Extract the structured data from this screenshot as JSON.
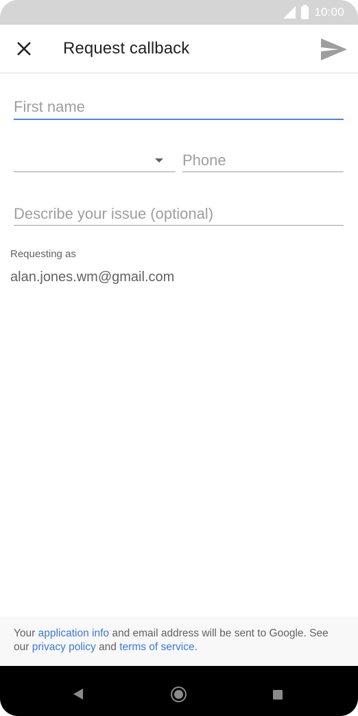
{
  "status_bar": {
    "time": "10:00",
    "icons": [
      "signal-icon",
      "battery-icon"
    ]
  },
  "app_bar": {
    "title": "Request callback",
    "close_icon": "close-icon",
    "send_icon": "send-icon"
  },
  "form": {
    "first_name": {
      "placeholder": "First name",
      "value": ""
    },
    "country_code": {
      "value": ""
    },
    "phone": {
      "placeholder": "Phone",
      "value": ""
    },
    "issue": {
      "placeholder": "Describe your issue (optional)",
      "value": ""
    }
  },
  "account": {
    "label": "Requesting as",
    "email": "alan.jones.wm@gmail.com"
  },
  "footer": {
    "text_1": "Your ",
    "link_app_info": "application info",
    "text_2": " and email address will be sent to Google. See our ",
    "link_privacy": "privacy policy",
    "text_3": " and ",
    "link_terms": "terms of service",
    "text_4": "."
  },
  "colors": {
    "accent": "#4a86e0",
    "link": "#3b78d8",
    "status_bar_bg": "#d5d5d5",
    "nav_bar_bg": "#000000"
  }
}
